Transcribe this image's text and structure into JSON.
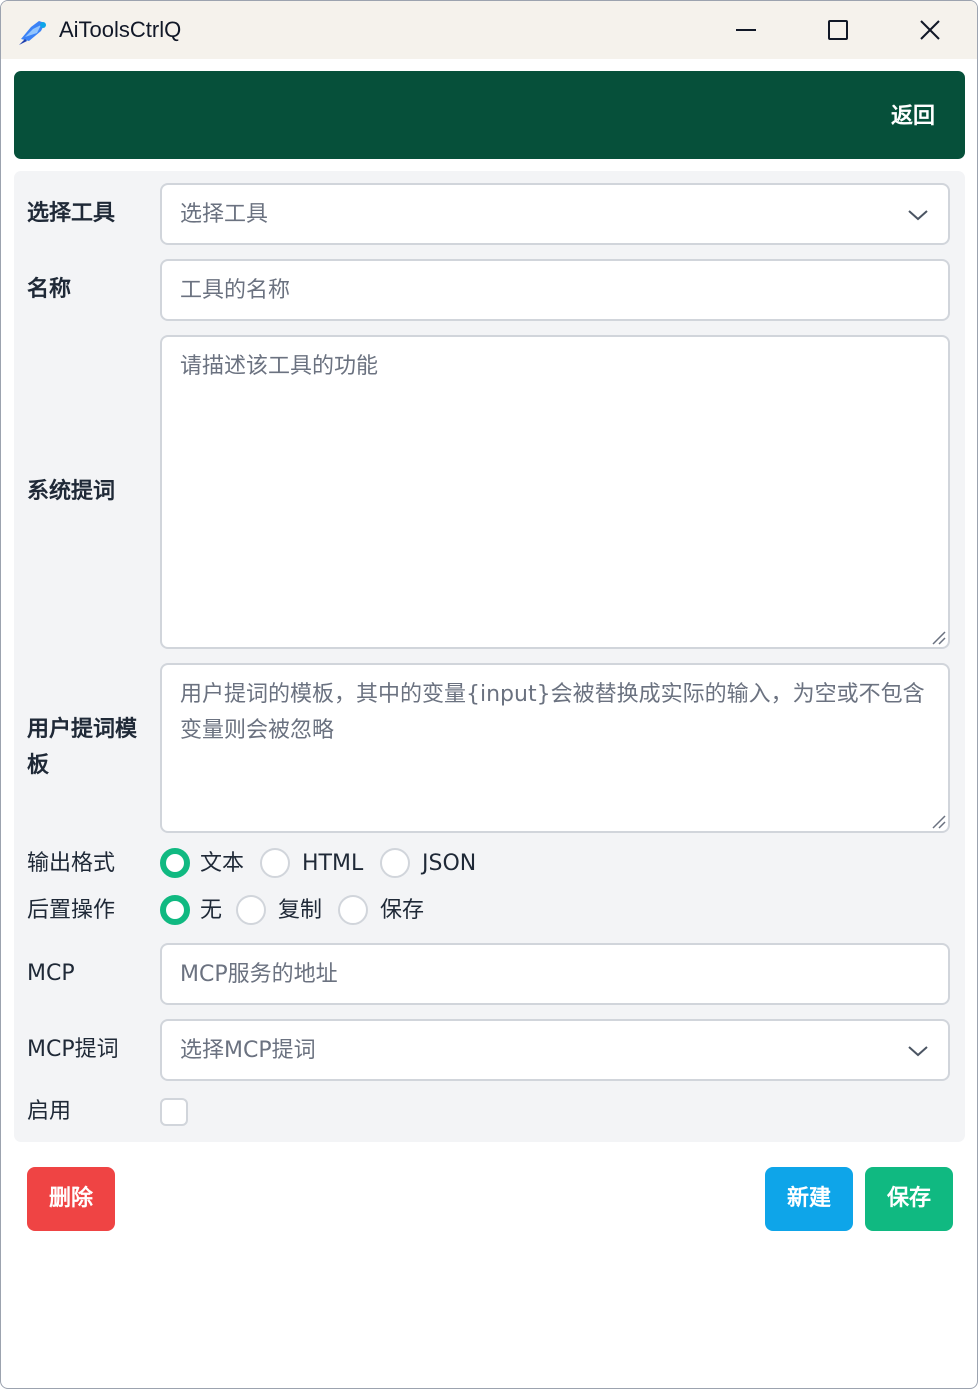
{
  "window": {
    "title": "AiToolsCtrlQ"
  },
  "header": {
    "back_label": "返回",
    "color": "#06503a"
  },
  "form": {
    "tool_select": {
      "label": "选择工具",
      "placeholder": "选择工具"
    },
    "name": {
      "label": "名称",
      "placeholder": "工具的名称"
    },
    "system_prompt": {
      "label": "系统提词",
      "placeholder": "请描述该工具的功能"
    },
    "user_prompt_template": {
      "label": "用户提词模板",
      "placeholder": "用户提词的模板，其中的变量{input}会被替换成实际的输入，为空或不包含变量则会被忽略"
    },
    "output_format": {
      "label": "输出格式",
      "options": [
        "文本",
        "HTML",
        "JSON"
      ],
      "selected": "文本"
    },
    "post_action": {
      "label": "后置操作",
      "options": [
        "无",
        "复制",
        "保存"
      ],
      "selected": "无"
    },
    "mcp": {
      "label": "MCP",
      "placeholder": "MCP服务的地址"
    },
    "mcp_prompt": {
      "label": "MCP提词",
      "placeholder": "选择MCP提词"
    },
    "enabled": {
      "label": "启用",
      "checked": false
    }
  },
  "actions": {
    "delete_label": "删除",
    "new_label": "新建",
    "save_label": "保存"
  },
  "colors": {
    "accent": "#10b981",
    "danger": "#ef4444",
    "info": "#0ea5e9"
  }
}
